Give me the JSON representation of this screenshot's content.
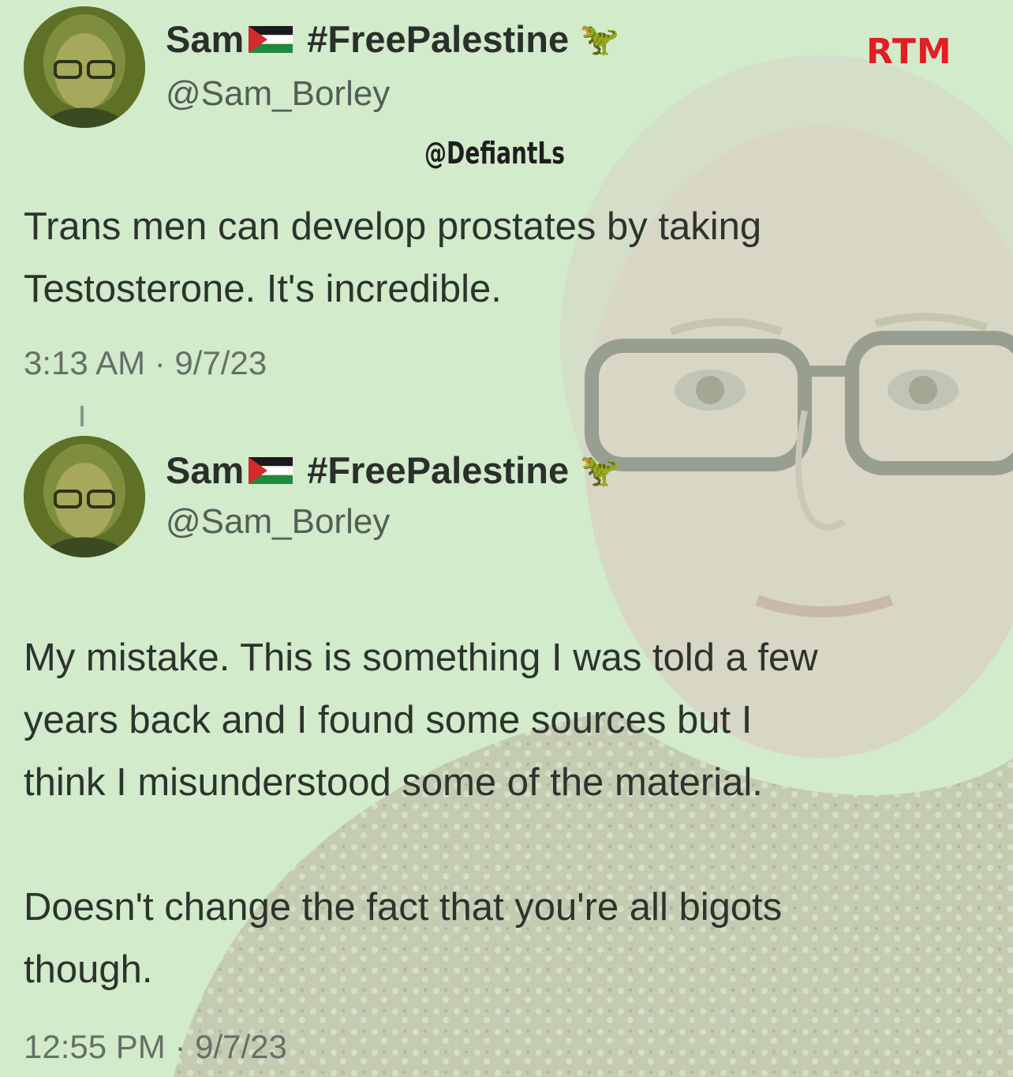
{
  "brand": {
    "logo_text": "RTM",
    "color": "#e01f25"
  },
  "watermark": {
    "text": "@DefiantLs"
  },
  "tweets": [
    {
      "display_name": "Sam",
      "hashtag": "#FreePalestine",
      "emoji": "🦖",
      "handle": "@Sam_Borley",
      "text": "Trans men can develop prostates by taking\nTestosterone. It's incredible.",
      "timestamp": "3:13 AM · 9/7/23"
    },
    {
      "display_name": "Sam",
      "hashtag": "#FreePalestine",
      "emoji": "🦖",
      "handle": "@Sam_Borley",
      "text": "My mistake. This is something I was told a few\nyears back and I found some sources but I\nthink I misunderstood some of the material.\n\nDoesn't change the fact that you're all bigots\nthough.",
      "timestamp": "12:55 PM · 9/7/23"
    }
  ],
  "colors": {
    "background": "#d2ebcb",
    "text": "#2d332d",
    "muted": "#667066"
  },
  "icons": {
    "flag": "palestine-flag-icon",
    "dino": "t-rex-icon"
  }
}
